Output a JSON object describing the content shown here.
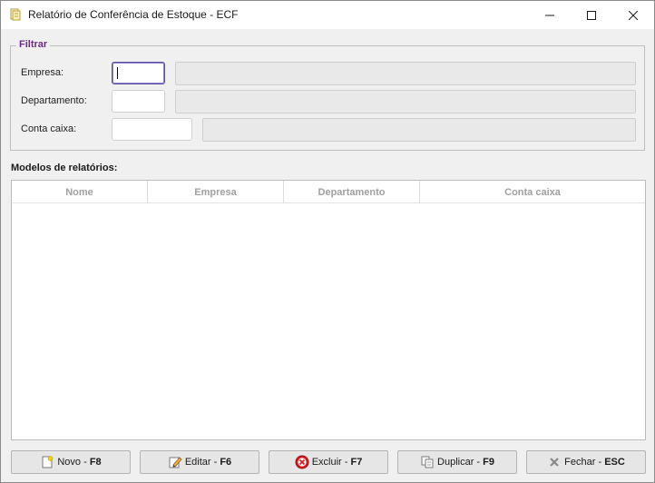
{
  "window": {
    "title": "Relatório de Conferência de Estoque - ECF"
  },
  "filter": {
    "legend": "Filtrar",
    "empresa_label": "Empresa:",
    "departamento_label": "Departamento:",
    "conta_caixa_label": "Conta caixa:",
    "empresa_code": "",
    "empresa_desc": "",
    "departamento_code": "",
    "departamento_desc": "",
    "conta_caixa_code": "",
    "conta_caixa_desc": ""
  },
  "models": {
    "label": "Modelos de relatórios:",
    "columns": [
      "Nome",
      "Empresa",
      "Departamento",
      "Conta caixa"
    ],
    "rows": []
  },
  "buttons": {
    "novo_label": "Novo - ",
    "novo_key": "F8",
    "editar_label": "Editar - ",
    "editar_key": "F6",
    "excluir_label": "Excluir - ",
    "excluir_key": "F7",
    "duplicar_label": "Duplicar - ",
    "duplicar_key": "F9",
    "fechar_label": "Fechar - ",
    "fechar_key": "ESC"
  },
  "colors": {
    "accent": "#6b2a86",
    "focus_border": "#5b4fa0",
    "header_text": "#a0a0a0"
  }
}
